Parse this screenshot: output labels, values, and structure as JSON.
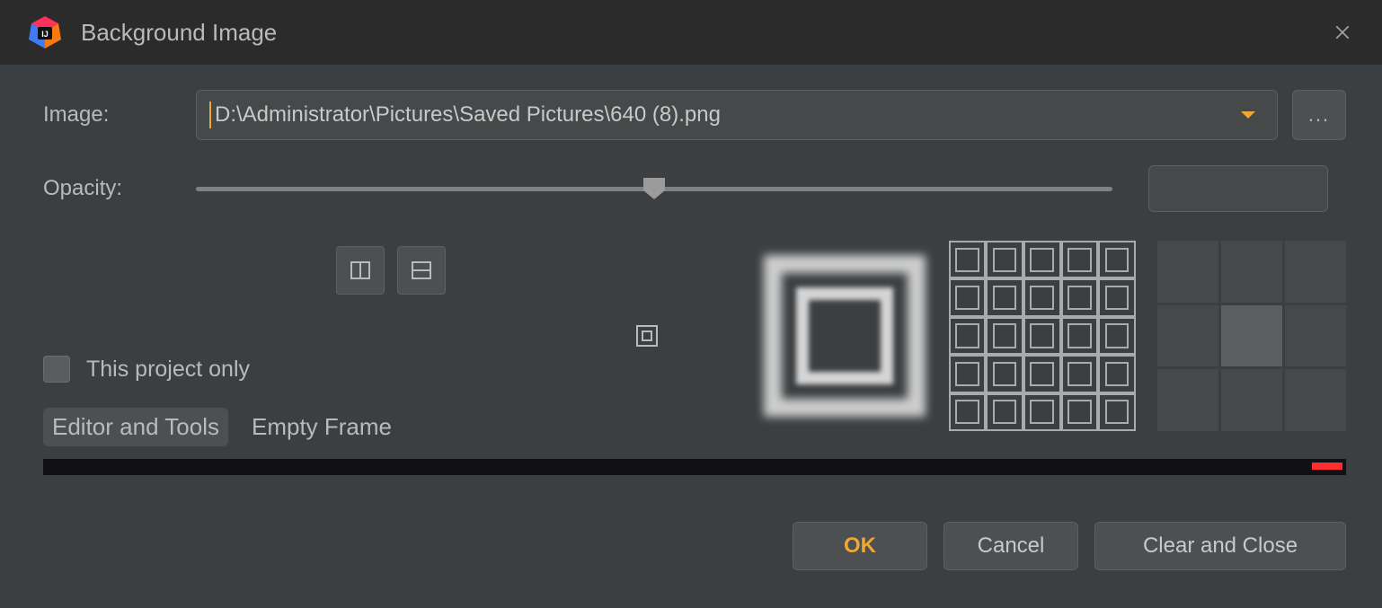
{
  "dialog": {
    "title": "Background Image"
  },
  "labels": {
    "image": "Image:",
    "opacity": "Opacity:",
    "projectOnly": "This project only"
  },
  "image": {
    "path": "D:\\Administrator\\Pictures\\Saved Pictures\\640 (8).png"
  },
  "opacity": {
    "value": "50",
    "percent": 50
  },
  "tabs": {
    "editor": "Editor and Tools",
    "emptyFrame": "Empty Frame",
    "active": "editor"
  },
  "buttons": {
    "ok": "OK",
    "cancel": "Cancel",
    "clearClose": "Clear and Close",
    "browse": "..."
  },
  "icons": {
    "flipH": "flip-h",
    "flipV": "flip-v",
    "plain": "fill-plain",
    "scale": "fill-scale",
    "tile": "fill-tile",
    "anchor": "anchor-grid"
  }
}
